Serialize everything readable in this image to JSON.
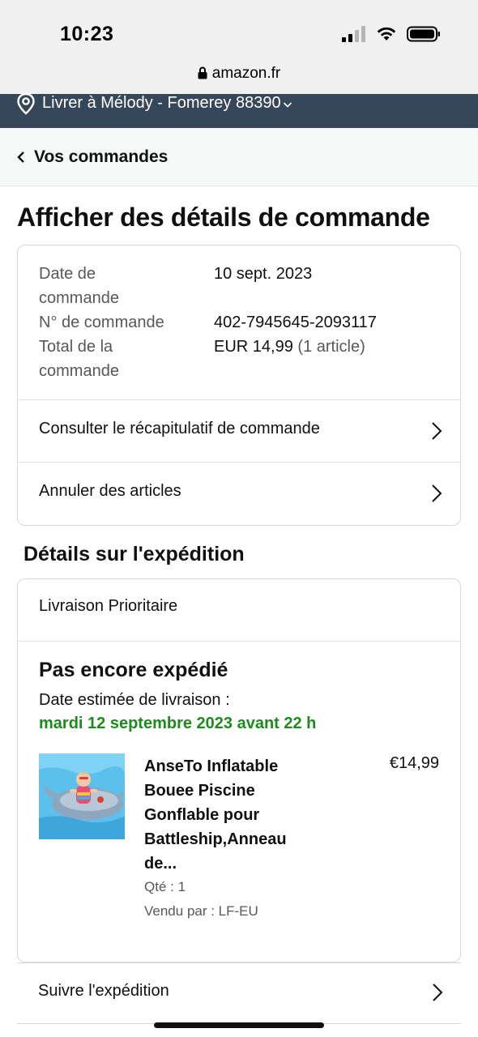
{
  "status_bar": {
    "time": "10:23",
    "icons": [
      "cellular-signal-icon",
      "wifi-icon",
      "battery-icon"
    ]
  },
  "browser": {
    "url": "amazon.fr"
  },
  "deliver_bar": {
    "text": "Livrer à Mélody - Fomerey 88390"
  },
  "nav": {
    "back_label": "Vos commandes"
  },
  "page": {
    "title": "Afficher des détails de commande"
  },
  "order": {
    "date_label_line1": "Date de",
    "date_label_line2": "commande",
    "date_value": "10 sept. 2023",
    "number_label": "N° de commande",
    "number_value": "402-7945645-2093117",
    "total_label_line1": "Total de la",
    "total_label_line2": "commande",
    "total_value": "EUR 14,99",
    "total_count": "(1 article)",
    "actions": {
      "summary": "Consulter le récapitulatif de commande",
      "cancel": "Annuler des articles"
    }
  },
  "shipment": {
    "section_title": "Détails sur l'expédition",
    "type": "Livraison Prioritaire",
    "status": "Pas encore expédié",
    "estimate_label": "Date estimée de livraison :",
    "estimate_date": "mardi 12 septembre 2023 avant 22 h",
    "product": {
      "title_line1": "AnseTo Inflatable",
      "title_line2": "Bouee Piscine",
      "title_line3": "Gonflable pour",
      "title_line4": "Battleship,Anneau",
      "title_line5": "de...",
      "price": "€14,99",
      "qty": "Qté : 1",
      "seller": "Vendu par : LF-EU"
    },
    "track_label": "Suivre l'expédition"
  },
  "colors": {
    "deliver_bar_bg": "#37475a",
    "estimate_green": "#1e8a1e",
    "border": "#d5d9d9"
  }
}
